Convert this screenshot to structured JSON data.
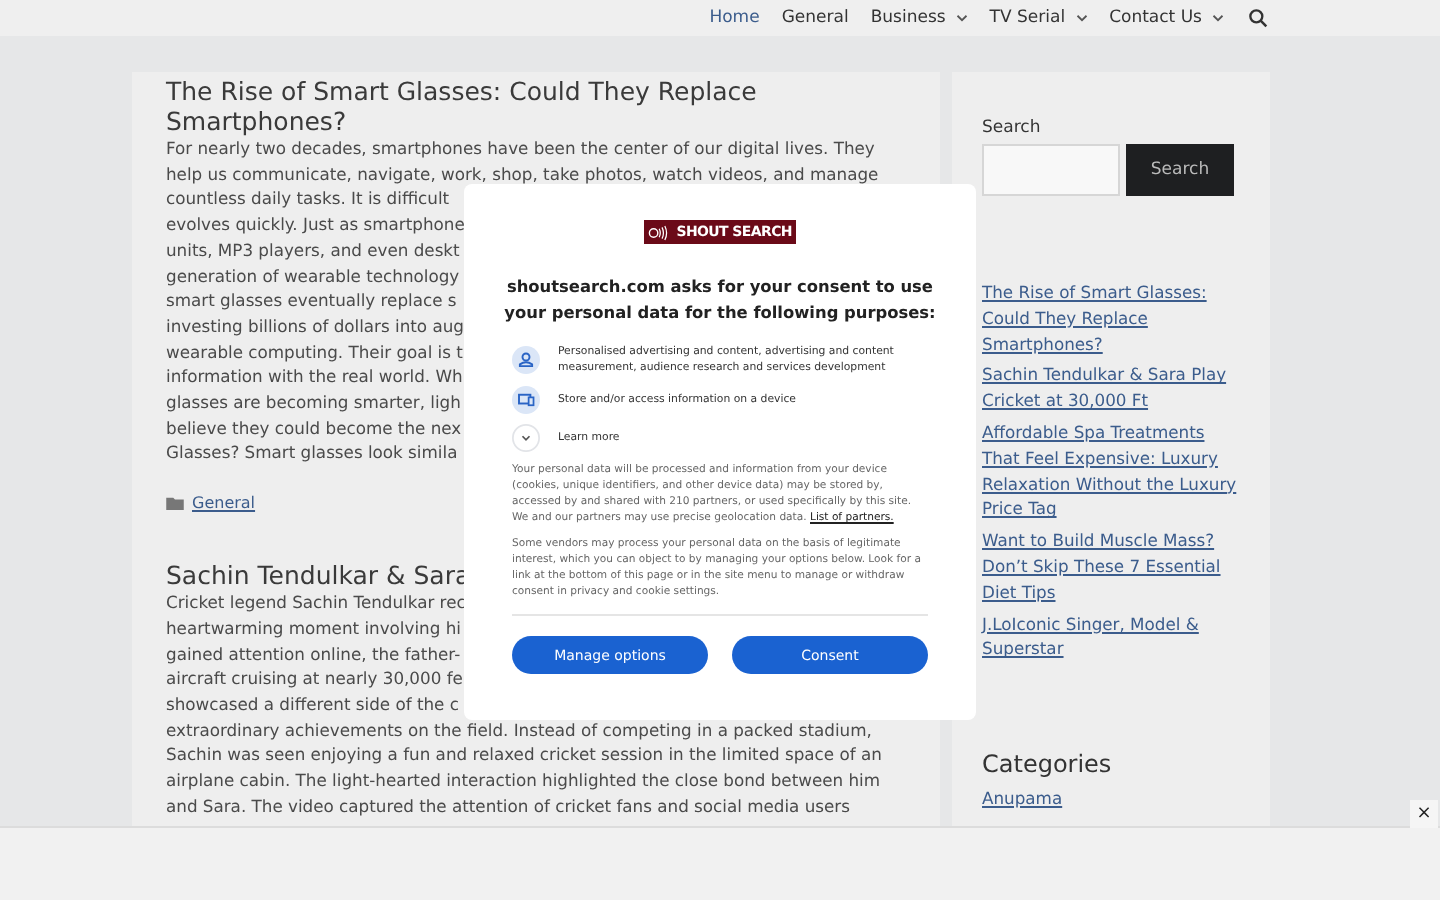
{
  "nav": {
    "items": [
      {
        "label": "Home",
        "selected": true,
        "has_menu": false
      },
      {
        "label": "General",
        "selected": false,
        "has_menu": false
      },
      {
        "label": "Business",
        "selected": false,
        "has_menu": true
      },
      {
        "label": "TV Serial",
        "selected": false,
        "has_menu": true
      },
      {
        "label": "Contact Us",
        "selected": false,
        "has_menu": true
      }
    ]
  },
  "articles": [
    {
      "title": "The Rise of Smart Glasses: Could They Replace Smartphones?",
      "lines": [
        "For nearly two decades, smartphones have been the center of our digital lives. They",
        "help us communicate, navigate, work, shop, take photos, watch videos, and manage",
        "countless daily tasks. It is difficult",
        "evolves quickly. Just as smartphone",
        "units, MP3 players, and even deskt",
        "generation of wearable technology",
        "smart glasses eventually replace s",
        "investing billions of dollars into aug",
        "wearable computing. Their goal is t",
        "information with the real world. Wh",
        "glasses are becoming smarter, ligh",
        "believe they could become the nex",
        "Glasses? Smart glasses look simila"
      ],
      "category": "General"
    },
    {
      "title": "Sachin Tendulkar & Sara",
      "lines": [
        "Cricket legend Sachin Tendulkar rec",
        "heartwarming moment involving hi",
        "gained attention online, the father-",
        "aircraft cruising at nearly 30,000 fe",
        "showcased a different side of the c",
        "extraordinary achievements on the field. Instead of competing in a packed stadium,",
        "Sachin was seen enjoying a fun and relaxed cricket session in the limited space of an",
        "airplane cabin. The light-hearted interaction highlighted the close bond between him",
        "and Sara. The video captured the attention of cricket fans and social media users"
      ]
    }
  ],
  "sidebar": {
    "search_label": "Search",
    "search_button": "Search",
    "recent_posts": [
      "The Rise of Smart Glasses: Could They Replace Smartphones?",
      "Sachin Tendulkar & Sara Play Cricket at 30,000 Ft",
      "Affordable Spa Treatments That Feel Expensive: Luxury Relaxation Without the Luxury Price Tag",
      "Want to Build Muscle Mass? Don’t Skip These 7 Essential Diet Tips",
      "J.LoIconic Singer, Model & Superstar"
    ],
    "categories_title": "Categories",
    "categories": [
      "Anupama"
    ]
  },
  "ad_close": "×",
  "consent": {
    "logo": "SHOUT SEARCH",
    "heading": "shoutsearch.com asks for your consent to use your personal data for the following purposes:",
    "purposes": [
      {
        "kind": "person",
        "text": "Personalised advertising and content, advertising and content measurement, audience research and services development"
      },
      {
        "kind": "device",
        "text": "Store and/or access information on a device"
      },
      {
        "kind": "expand",
        "text": "Learn more"
      }
    ],
    "paragraph_1": "Your personal data will be processed and information from your device (cookies, unique identifiers, and other device data) may be stored by, accessed by and shared with 210 partners, or used specifically by this site. We and our partners may use precise geolocation data.",
    "partners_link": "List of partners.",
    "paragraph_2": "Some vendors may process your personal data on the basis of legitimate interest, which you can object to by managing your options below. Look for a link at the bottom of this page or in the site menu to manage or withdraw consent in privacy and cookie settings.",
    "buttons": [
      "Manage options",
      "Consent"
    ]
  }
}
